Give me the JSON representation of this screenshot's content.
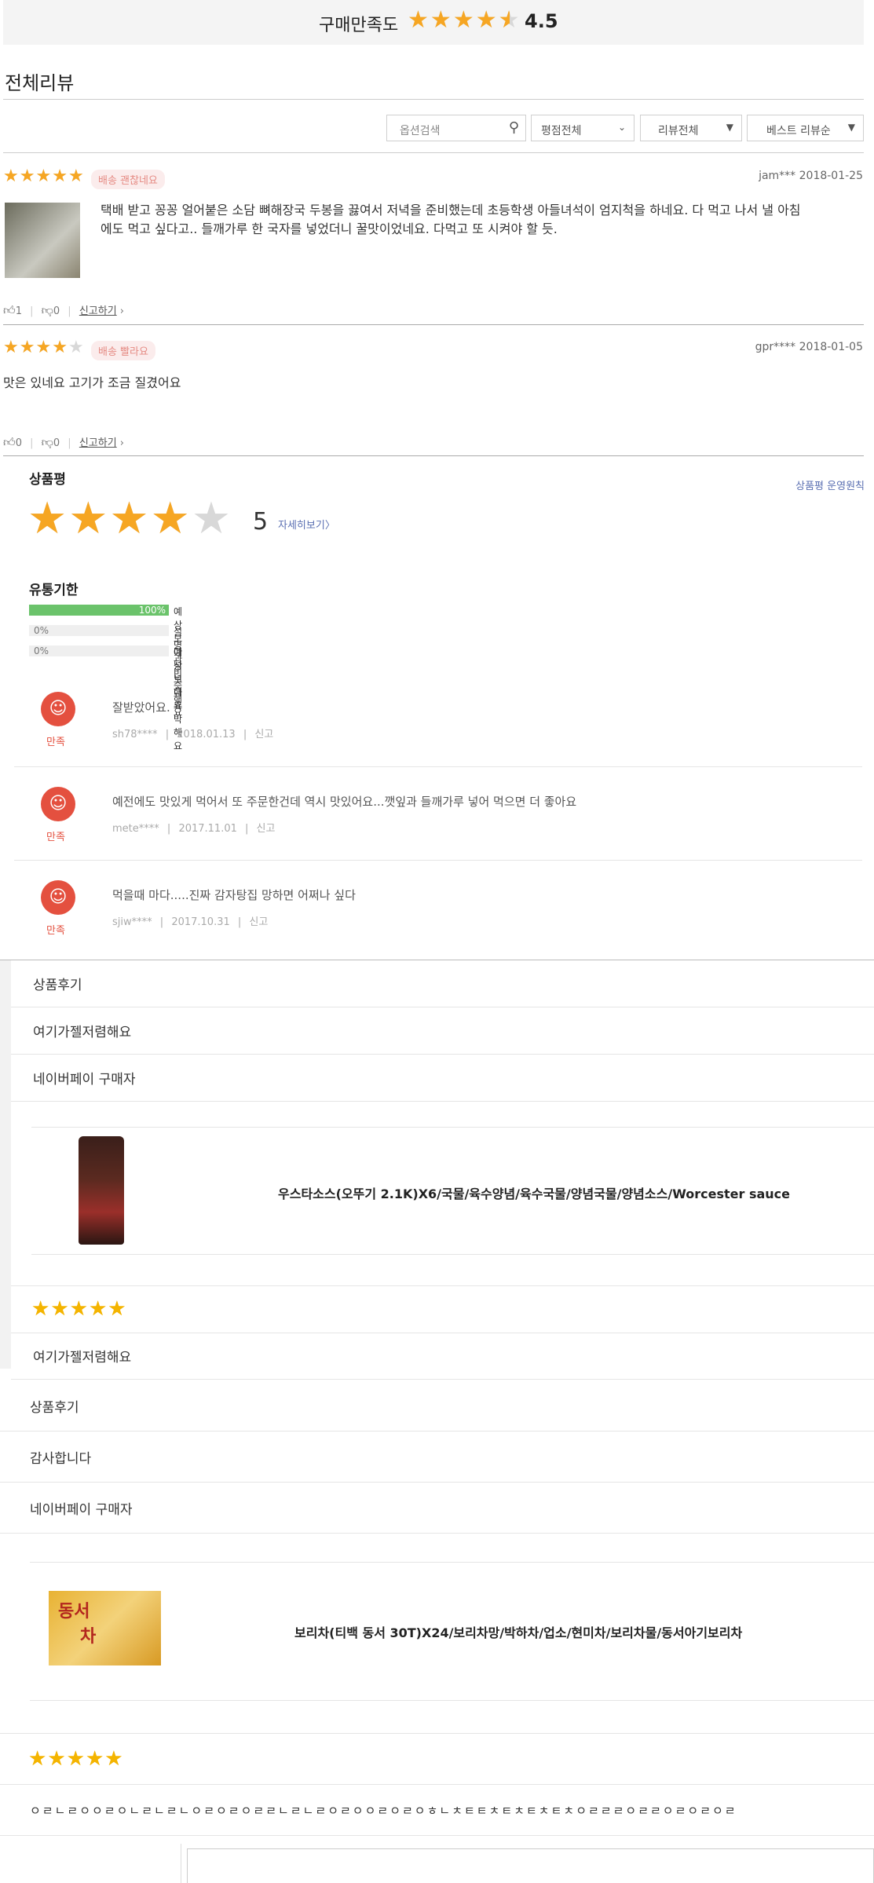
{
  "header": {
    "satisfaction_label": "구매만족도",
    "score": "4.5",
    "rating": 4.5
  },
  "reviews_title": "전체리뷰",
  "controls": {
    "search_placeholder": "옵션검색",
    "rating_filter": "평점전체",
    "review_filter": "리뷰전체",
    "sort": "베스트 리뷰순"
  },
  "reviews": [
    {
      "rating": 5,
      "badge": "배송 괜찮네요",
      "user": "jam***",
      "date": "2018-01-25",
      "text_line1": "택배 받고 꽁꽁 얼어붙은 소담 뼈해장국 두봉을 끓여서 저녁을 준비했는데 초등학생 아들녀석이 엄지척을 하네요. 다 먹고 나서 낼 아침",
      "text_line2": "에도 먹고 싶다고.. 들깨가루 한 국자를 넣었더니 꿀맛이었네요. 다먹고 또 시켜야 할 듯.",
      "likes": "1",
      "dislikes": "0",
      "report": "신고하기"
    },
    {
      "rating": 4,
      "badge": "배송 빨라요",
      "user": "gpr****",
      "date": "2018-01-05",
      "text_line1": "맛은 있네요 고기가 조금 질겼어요",
      "likes": "0",
      "dislikes": "0",
      "report": "신고하기"
    }
  ],
  "product_review": {
    "title": "상품평",
    "policy_link": "상품평 운영원칙",
    "rating": 4,
    "count": "5",
    "more_link": "자세히보기"
  },
  "expiry": {
    "title": "유통기한",
    "bars": [
      {
        "pct_label": "100%",
        "fraction": 1.0,
        "label": "예상보다 넉넉해요"
      },
      {
        "pct_label": "0%",
        "fraction": 0,
        "label": "설명과 비슷해요"
      },
      {
        "pct_label": "0%",
        "fraction": 0,
        "label": "예상보다 촉박해요"
      }
    ]
  },
  "comments": [
    {
      "status": "만족",
      "text": "잘받았어요.",
      "user": "sh78****",
      "date": "2018.01.13",
      "report": "신고"
    },
    {
      "status": "만족",
      "text": "예전에도 맛있게 먹어서 또 주문한건데 역시 맛있어요...깻잎과 들깨가루 넣어 먹으면 더 좋아요",
      "user": "mete****",
      "date": "2017.11.01",
      "report": "신고"
    },
    {
      "status": "만족",
      "text": "먹을때 마다.....진짜 감자탕집 망하면 어쩌나 싶다",
      "user": "sjiw****",
      "date": "2017.10.31",
      "report": "신고"
    }
  ],
  "block1": {
    "heading": "상품후기",
    "line2": "여기가젤저렴해요",
    "line3": "네이버페이 구매자",
    "product_title": "우스타소스(오뚜기 2.1K)X6/국물/육수양념/육수국물/양념국물/양념소스/Worcester sauce",
    "rating": 5,
    "footer": "여기가젤저렴해요"
  },
  "block2": {
    "heading": "상품후기",
    "line2": "감사합니다",
    "line3": "네이버페이 구매자",
    "image_text_1": "동서",
    "image_text_2": "차",
    "product_title": "보리차(티백 동서 30T)X24/보리차망/박하차/업소/현미차/보리차물/동서아기보리차",
    "rating": 5,
    "footer": "ㅇㄹㄴㄹㅇㅇㄹㅇㄴㄹㄴㄹㄴㅇㄹㅇㄹㅇㄹㄹㄴㄹㄴㄹㅇㄹㅇㅇㄹㅇㄹㅇㅎㄴㅊㅌㅌㅊㅌㅊㅌㅊㅌㅊㅇㄹㄹㄹㅇㄹㄹㅇㄹㅇㄹㅇㄹ"
  },
  "colors": {
    "star": "#f6a623",
    "gold_star": "#f4b400",
    "smile": "#e4503f",
    "bar": "#6bc36b",
    "link": "#5a6fb2"
  }
}
